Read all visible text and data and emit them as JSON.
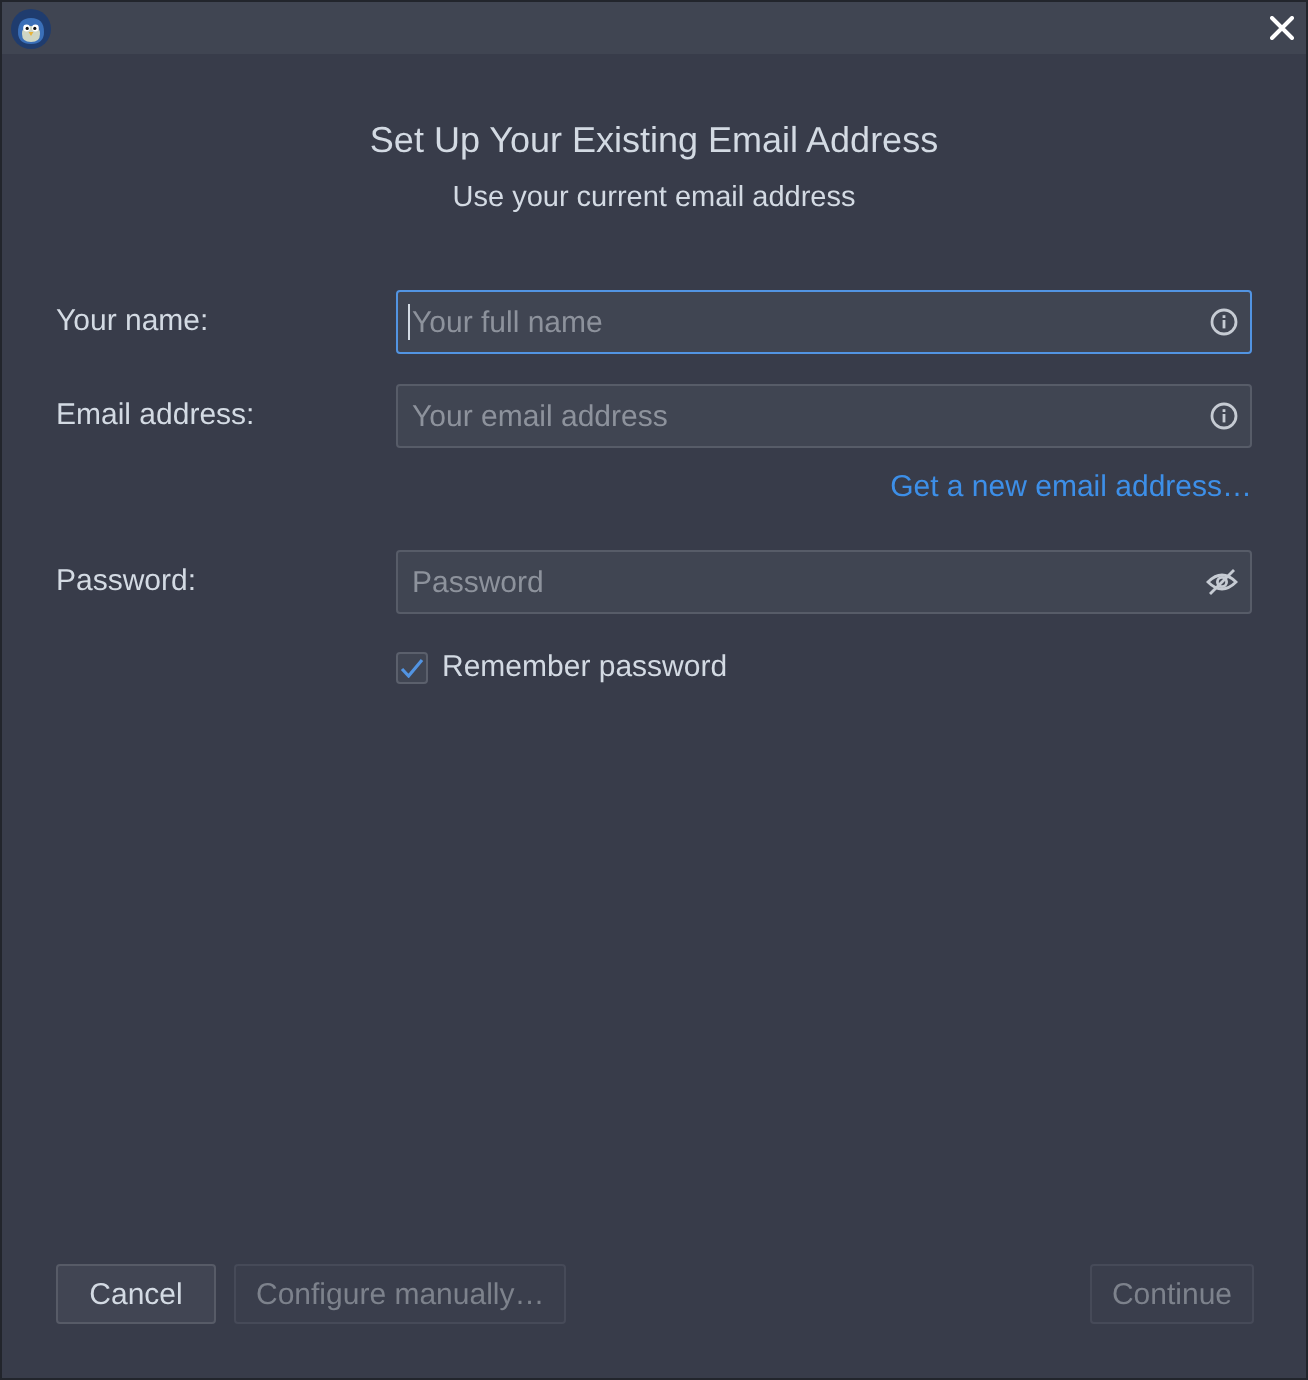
{
  "heading": {
    "title": "Set Up Your Existing Email Address",
    "subtitle": "Use your current email address"
  },
  "rows": [
    {
      "kind": "text",
      "label": "Your name:",
      "placeholder": "Your full name",
      "focused": true
    },
    {
      "kind": "text",
      "label": "Email address:",
      "placeholder": "Your email address",
      "focused": false
    },
    {
      "kind": "link",
      "label": "Get a new email address…"
    },
    {
      "kind": "password",
      "label": "Password:",
      "placeholder": "Password",
      "focused": false
    },
    {
      "kind": "checkbox",
      "label": "Remember password",
      "checked": true
    }
  ],
  "buttons_left": [
    {
      "label": "Cancel",
      "disabled": false
    },
    {
      "label": "Configure manually…",
      "disabled": true
    }
  ],
  "buttons_right": [
    {
      "label": "Continue",
      "disabled": true
    }
  ]
}
